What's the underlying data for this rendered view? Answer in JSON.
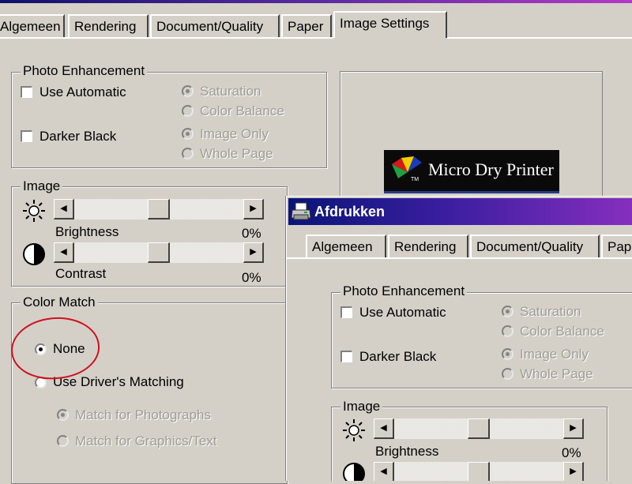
{
  "tabs": [
    "Algemeen",
    "Rendering",
    "Document/Quality",
    "Paper",
    "Image Settings"
  ],
  "photo_enhancement": {
    "title": "Photo Enhancement",
    "use_automatic": "Use Automatic",
    "darker_black": "Darker Black",
    "saturation": "Saturation",
    "color_balance": "Color Balance",
    "image_only": "Image Only",
    "whole_page": "Whole Page"
  },
  "image": {
    "title": "Image",
    "brightness_label": "Brightness",
    "brightness_value": "0%",
    "contrast_label": "Contrast",
    "contrast_value": "0%"
  },
  "color_match": {
    "title": "Color Match",
    "none": "None",
    "use_driver": "Use Driver's Matching",
    "match_photos": "Match for Photographs",
    "match_graphics": "Match for Graphics/Text",
    "selected": "None"
  },
  "logo": {
    "text": "Micro Dry Printer",
    "tm": "TM"
  },
  "dialog": {
    "title": "Afdrukken",
    "tabs": [
      "Algemeen",
      "Rendering",
      "Document/Quality",
      "Pap"
    ],
    "photo_enhancement": {
      "title": "Photo Enhancement",
      "use_automatic": "Use Automatic",
      "darker_black": "Darker Black",
      "saturation": "Saturation",
      "color_balance": "Color Balance",
      "image_only": "Image Only",
      "whole_page": "Whole Page"
    },
    "image": {
      "title": "Image",
      "brightness_label": "Brightness",
      "brightness_value": "0%"
    }
  },
  "colors": {
    "annotation": "#d01020",
    "dialog_face": "#d4d0c8",
    "titlebar_start": "#0a1578",
    "titlebar_end": "#8a30c0"
  },
  "icons": [
    "brightness-sun-icon",
    "contrast-icon",
    "printer-icon",
    "arrow-left-icon",
    "arrow-right-icon"
  ]
}
